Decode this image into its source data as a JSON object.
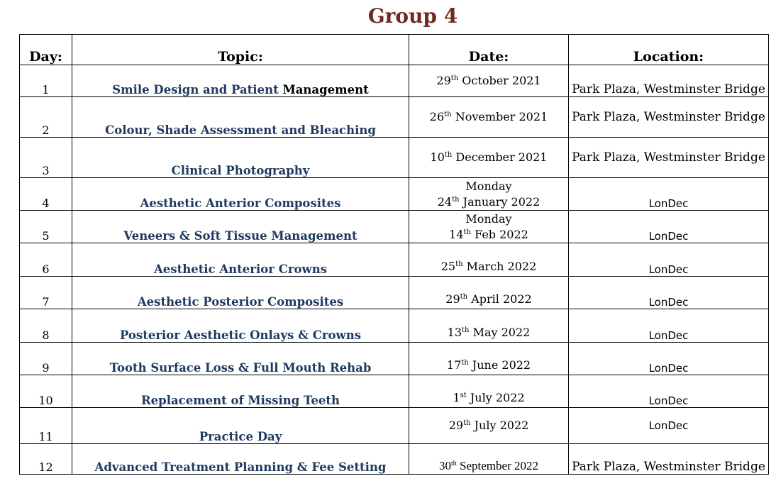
{
  "title": "Group 4",
  "headers": {
    "day": "Day:",
    "topic": "Topic:",
    "date": "Date:",
    "location": "Location:"
  },
  "rows": [
    {
      "day": "1",
      "topic_a": "Smile Design and Patient",
      "topic_b": "Management",
      "date_prefix": "",
      "date_num": "29",
      "date_sup": "th",
      "date_rest": " October 2021",
      "location": "Park Plaza, Westminster Bridge"
    },
    {
      "day": "2",
      "topic": "Colour, Shade Assessment and Bleaching",
      "date_prefix": "",
      "date_num": "26",
      "date_sup": "th",
      "date_rest": " November 2021",
      "location": "Park Plaza, Westminster Bridge"
    },
    {
      "day": "3",
      "topic": "Clinical Photography",
      "date_prefix": "",
      "date_num": "10",
      "date_sup": "th",
      "date_rest": " December 2021",
      "location": "Park Plaza, Westminster Bridge"
    },
    {
      "day": "4",
      "topic": "Aesthetic Anterior Composites",
      "date_prefix": "Monday",
      "date_num": "24",
      "date_sup": "th",
      "date_rest": " January 2022",
      "location": "LonDec"
    },
    {
      "day": "5",
      "topic": "Veneers & Soft Tissue Management",
      "date_prefix": "Monday",
      "date_num": "14",
      "date_sup": "th",
      "date_rest": " Feb 2022",
      "location": "LonDec"
    },
    {
      "day": "6",
      "topic": "Aesthetic Anterior Crowns",
      "date_prefix": "",
      "date_num": "25",
      "date_sup": "th",
      "date_rest": " March 2022",
      "location": "LonDec"
    },
    {
      "day": "7",
      "topic": "Aesthetic Posterior Composites",
      "date_prefix": "",
      "date_num": "29",
      "date_sup": "th",
      "date_rest": " April 2022",
      "location": "LonDec"
    },
    {
      "day": "8",
      "topic": "Posterior Aesthetic Onlays & Crowns",
      "date_prefix": "",
      "date_num": "13",
      "date_sup": "th",
      "date_rest": " May 2022",
      "location": "LonDec"
    },
    {
      "day": "9",
      "topic": "Tooth Surface Loss & Full Mouth Rehab",
      "date_prefix": "",
      "date_num": "17",
      "date_sup": "th",
      "date_rest": " June 2022",
      "location": "LonDec"
    },
    {
      "day": "10",
      "topic": "Replacement of Missing Teeth",
      "date_prefix": "",
      "date_num": "1",
      "date_sup": "st",
      "date_rest": " July 2022",
      "location": "LonDec"
    },
    {
      "day": "11",
      "topic": "Practice Day",
      "date_prefix": "",
      "date_num": "29",
      "date_sup": "th",
      "date_rest": " July 2022",
      "location": "LonDec"
    },
    {
      "day": "12",
      "topic": "Advanced Treatment Planning & Fee Setting",
      "date_prefix": "",
      "date_num": "30",
      "date_sup": "th",
      "date_rest": " September 2022",
      "location": "Park Plaza, Westminster Bridge"
    }
  ]
}
